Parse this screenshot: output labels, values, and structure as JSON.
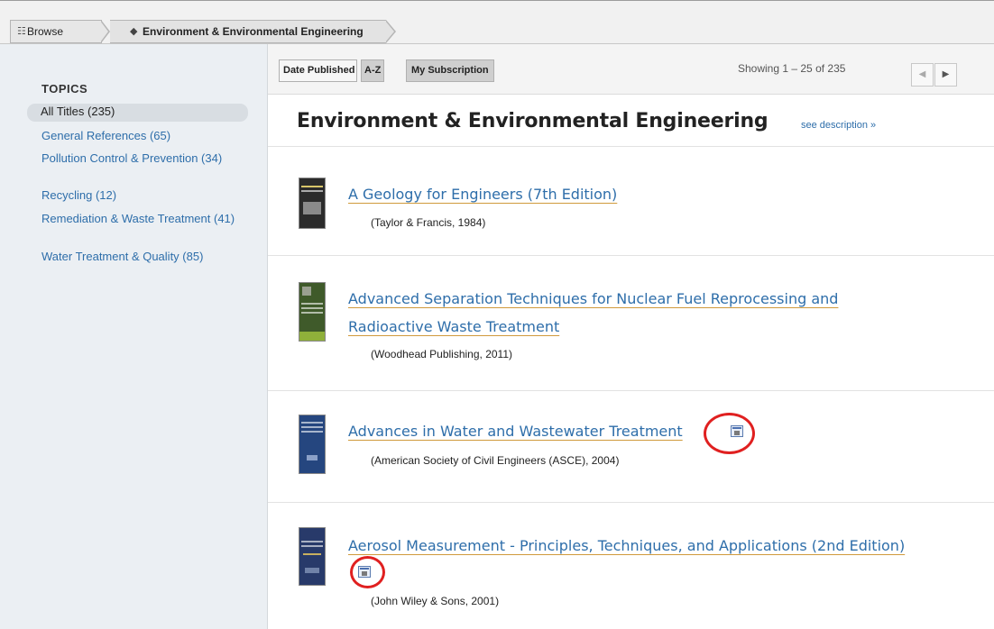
{
  "breadcrumb": {
    "browse_label": "Browse",
    "current_label": "Environment & Environmental Engineering"
  },
  "sidebar": {
    "title": "TOPICS",
    "items": [
      {
        "label": "All Titles (235)",
        "active": true
      },
      {
        "label": "General References (65)"
      },
      {
        "label": "Pollution Control & Prevention (34)"
      },
      {
        "label": "Recycling (12)"
      },
      {
        "label": "Remediation & Waste Treatment (41)"
      },
      {
        "label": "Water Treatment & Quality (85)"
      }
    ]
  },
  "toolbar": {
    "sort_date_label": "Date Published",
    "sort_az_label": "A-Z",
    "subscription_label": "My Subscription",
    "showing_text": "Showing 1 – 25 of 235",
    "prev_label": "◀",
    "next_label": "▶"
  },
  "main": {
    "heading": "Environment & Environmental Engineering",
    "see_description": "see description »",
    "books": [
      {
        "title": "A Geology for Engineers (7th Edition)",
        "publisher": "(Taylor & Francis, 1984)",
        "cover_color": "#2b2b2b"
      },
      {
        "title_line1": "Advanced Separation Techniques for Nuclear Fuel Reprocessing and",
        "title_line2": "Radioactive Waste Treatment",
        "publisher": "(Woodhead Publishing, 2011)",
        "cover_color": "#3f5a2a"
      },
      {
        "title": "Advances in Water and Wastewater Treatment",
        "publisher": "(American Society of Civil Engineers (ASCE), 2004)",
        "cover_color": "#25467f",
        "has_ebook_icon": true
      },
      {
        "title": "Aerosol Measurement - Principles, Techniques, and Applications (2nd Edition)",
        "publisher": "(John Wiley & Sons, 2001)",
        "cover_color": "#283a6a",
        "has_ebook_icon": true
      }
    ]
  },
  "colors": {
    "link": "#2e6eaa",
    "underline": "#d09a3c",
    "annotation": "#e02020"
  }
}
